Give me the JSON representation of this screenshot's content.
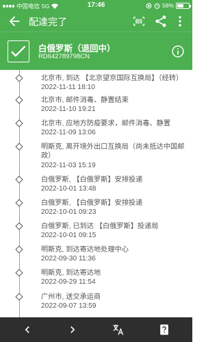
{
  "status_bar": {
    "carrier": "中国电信",
    "network": "5G",
    "time": "17:46",
    "battery": "58%",
    "battery_level": 0.58
  },
  "toolbar": {
    "title": "配達完了"
  },
  "package": {
    "title": "白俄罗斯（退回中）",
    "tracking_number": "RD642789798CN"
  },
  "events": [
    {
      "text": "北京市, 到达 【北京望京国际互换局】（经转）",
      "time": "2022-11-11 18:10"
    },
    {
      "text": "北京市, 邮件消毒、静置结束",
      "time": "2022-11-10 19:21"
    },
    {
      "text": "北京市, 应地方防疫要求，邮件消毒、静置",
      "time": "2022-11-09 13:06"
    },
    {
      "text": "明斯克, 离开境外出口互换局（尚未抵达中国邮政）",
      "time": "2022-11-03 15:19"
    },
    {
      "text": "白俄罗斯, 【白俄罗斯】安排投递",
      "time": "2022-10-01 13:48"
    },
    {
      "text": "白俄罗斯, 【白俄罗斯】安排投递",
      "time": "2022-10-01 09:23"
    },
    {
      "text": "白俄罗斯, 已到达 【白俄罗斯】投递局",
      "time": "2022-10-01 09:15"
    },
    {
      "text": "明斯克, 到达寄达地处理中心",
      "time": "2022-09-30 11:36"
    },
    {
      "text": "明斯克, 到达寄达地",
      "time": "2022-09-29 11:54"
    },
    {
      "text": "广州市, 送交承运商",
      "time": "2022-09-07 13:59"
    }
  ],
  "colors": {
    "primary": "#4caf50",
    "bottom_bar": "#2e2e2e"
  },
  "icons": [
    "back-arrow-icon",
    "barcode-icon",
    "share-icon",
    "more-vert-icon",
    "check-icon",
    "info-icon",
    "diamond-icon",
    "chevron-left-icon",
    "chevron-right-icon",
    "translate-icon",
    "help-icon"
  ]
}
